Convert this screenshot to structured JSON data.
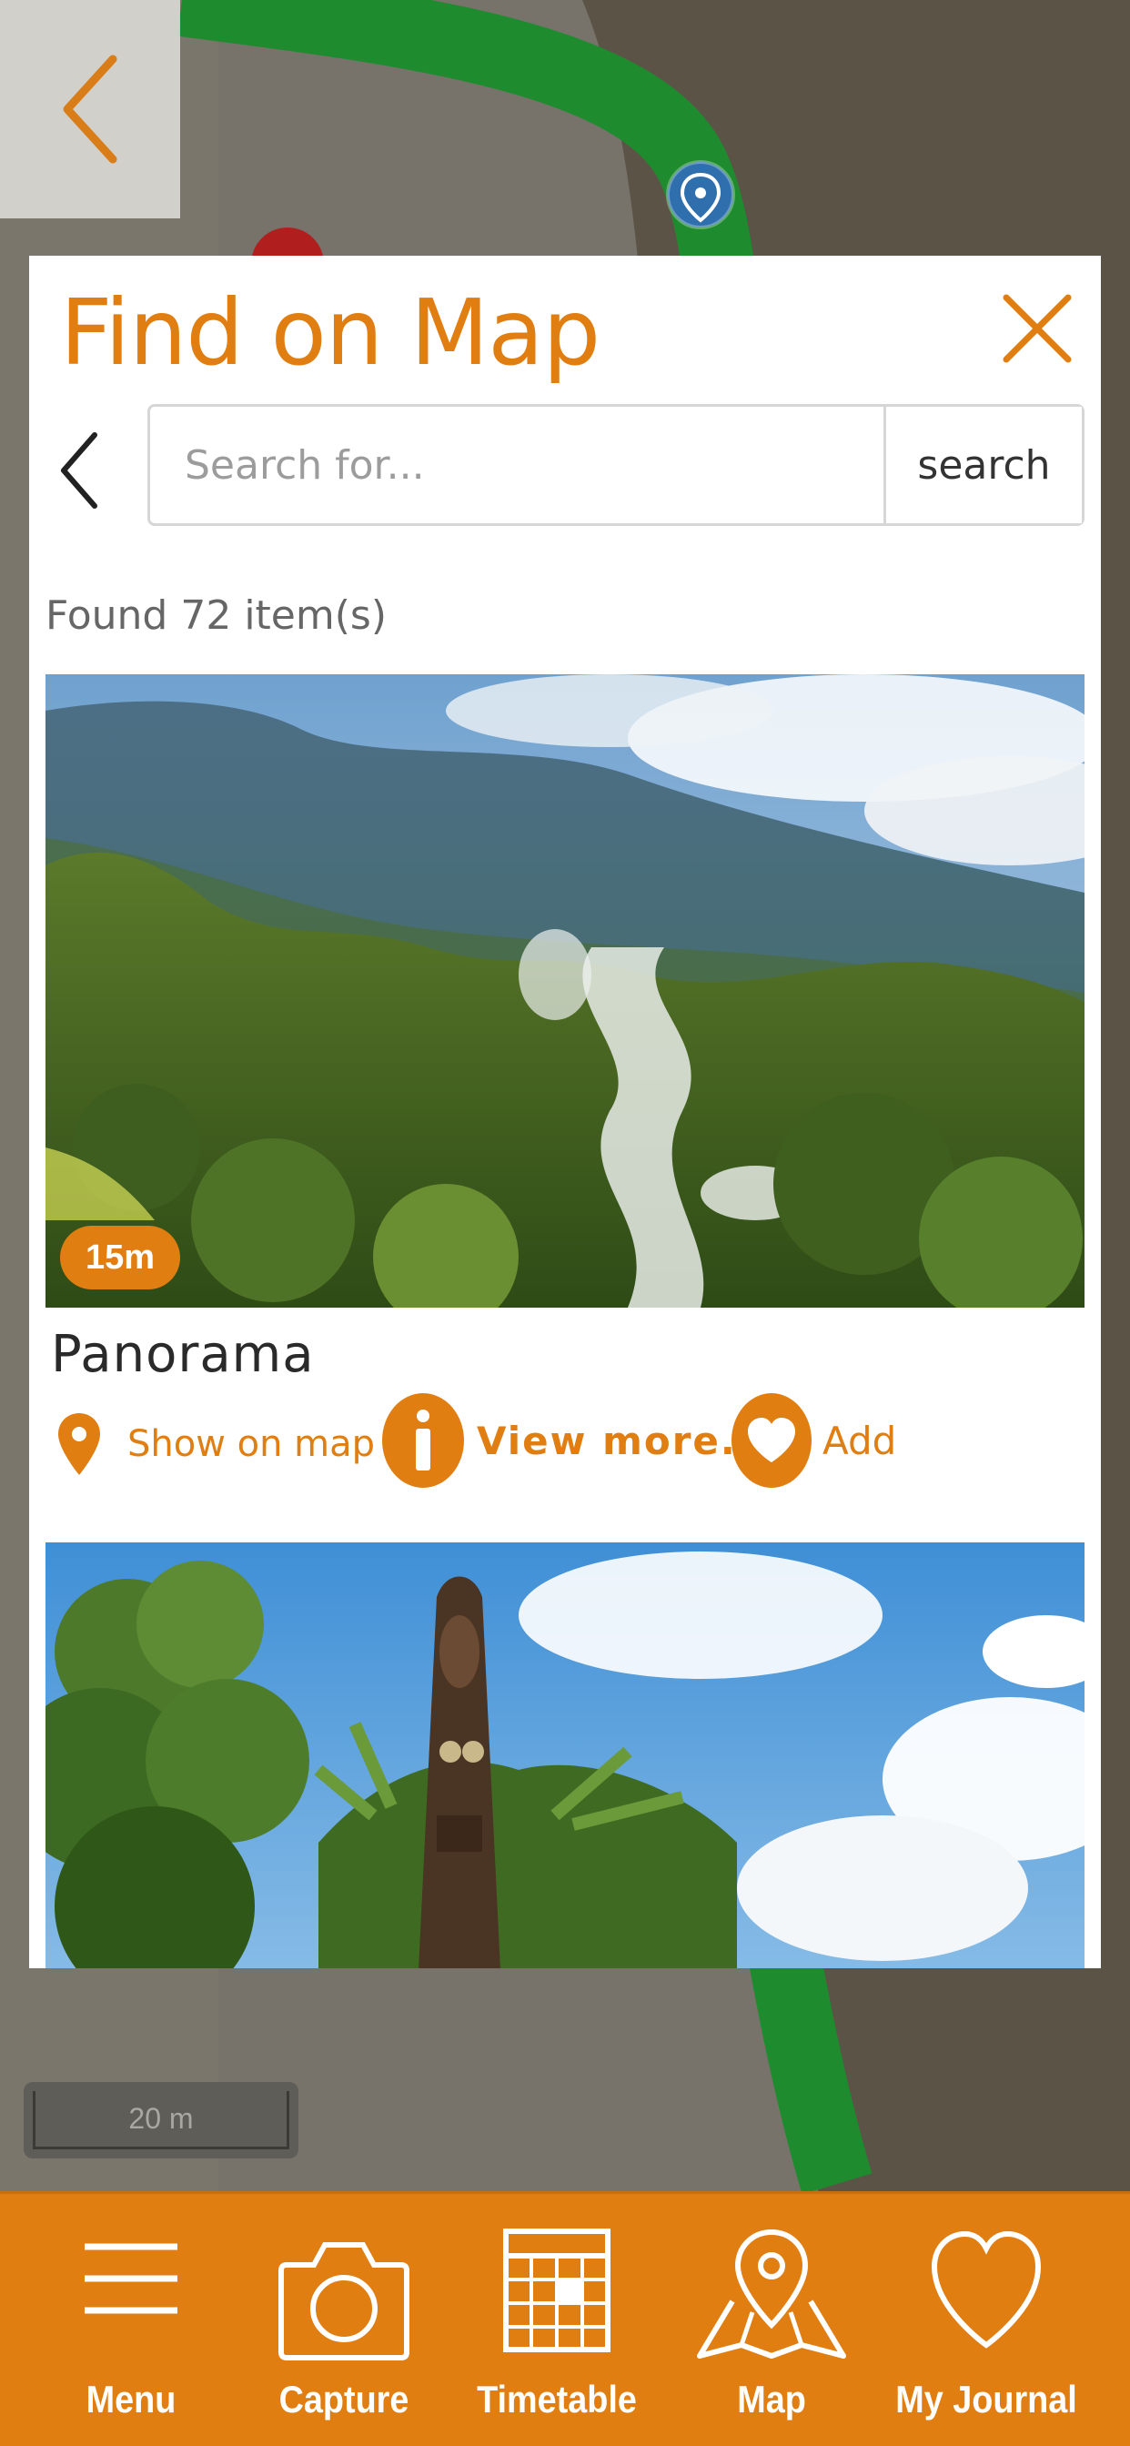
{
  "modal": {
    "title": "Find on Map",
    "search": {
      "placeholder": "Search for...",
      "button_label": "search"
    },
    "results_text": "Found 72 item(s)",
    "results": [
      {
        "title": "Panorama",
        "distance": "15m",
        "actions": {
          "show_on_map": "Show on map",
          "view_more": "View more...",
          "add": "Add"
        }
      },
      {
        "title": ""
      }
    ]
  },
  "map": {
    "scale_label": "20 m"
  },
  "nav": {
    "items": [
      {
        "label": "Menu",
        "icon": "menu-icon"
      },
      {
        "label": "Capture",
        "icon": "camera-icon"
      },
      {
        "label": "Timetable",
        "icon": "calendar-icon"
      },
      {
        "label": "Map",
        "icon": "map-icon"
      },
      {
        "label": "My Journal",
        "icon": "heart-icon"
      }
    ]
  },
  "colors": {
    "accent": "#e07e12",
    "route": "#1e8c2e",
    "map_bg": "#77736a"
  }
}
